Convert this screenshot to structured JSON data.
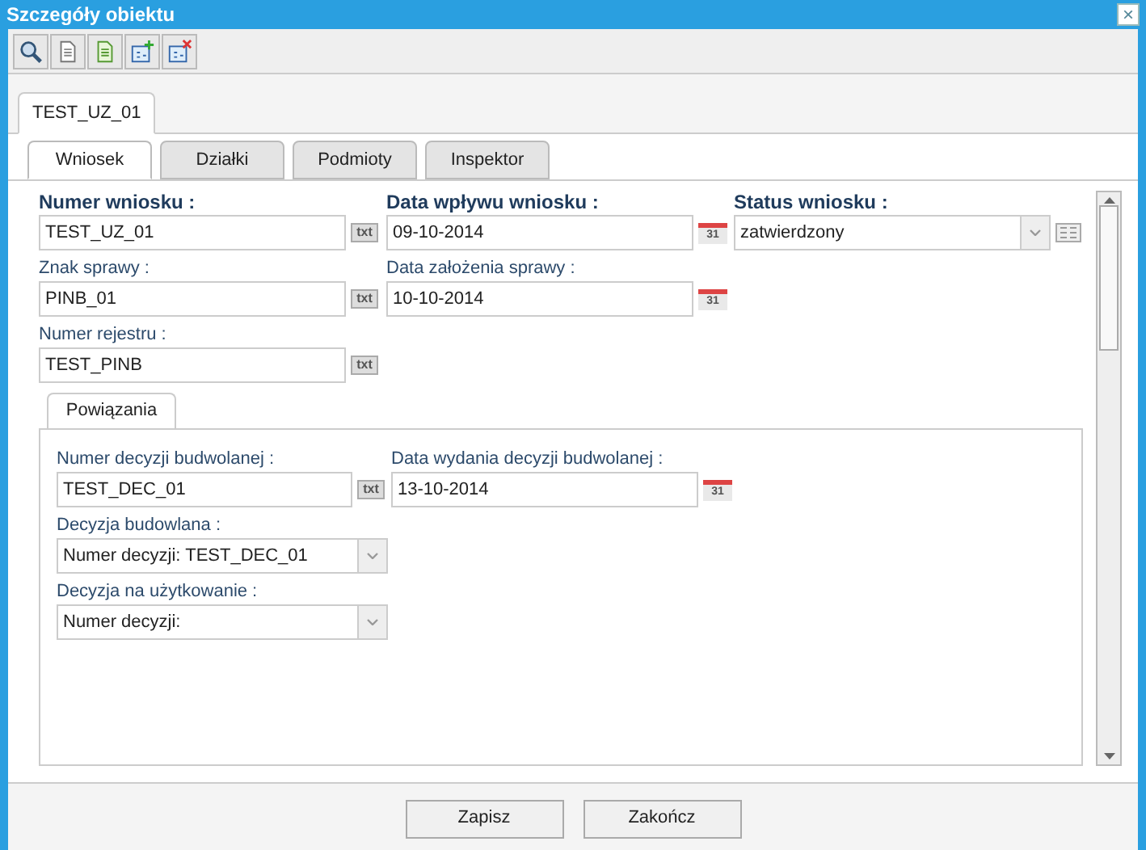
{
  "window": {
    "title": "Szczegóły obiektu",
    "close": "×"
  },
  "toolbar": [
    {
      "kind": "search"
    },
    {
      "kind": "doc"
    },
    {
      "kind": "doc-green"
    },
    {
      "kind": "add"
    },
    {
      "kind": "remove"
    }
  ],
  "object_tabs": [
    {
      "label": "TEST_UZ_01",
      "selected": true
    }
  ],
  "tabs": [
    {
      "label": "Wniosek",
      "selected": true
    },
    {
      "label": "Działki",
      "selected": false
    },
    {
      "label": "Podmioty",
      "selected": false
    },
    {
      "label": "Inspektor",
      "selected": false
    }
  ],
  "fields": [
    {
      "label": "Numer wniosku :",
      "required": true,
      "kind": "text",
      "value": "TEST_UZ_01",
      "button": "txt"
    },
    {
      "label": "Data wpływu wniosku :",
      "required": true,
      "kind": "date",
      "value": "09-10-2014",
      "button": "31"
    },
    {
      "label": "Status wniosku :",
      "required": true,
      "kind": "select",
      "value": "zatwierdzony"
    },
    {
      "label": "Znak sprawy :",
      "required": false,
      "kind": "text",
      "value": "PINB_01",
      "button": "txt"
    },
    {
      "label": "Data założenia sprawy :",
      "required": false,
      "kind": "date",
      "value": "10-10-2014",
      "button": "31"
    },
    {
      "kind": "empty"
    },
    {
      "label": "Numer rejestru :",
      "required": false,
      "kind": "text",
      "value": "TEST_PINB",
      "button": "txt"
    }
  ],
  "sub_tabs": [
    {
      "label": "Powiązania",
      "selected": true
    }
  ],
  "sub_fields": [
    {
      "label": "Numer decyzji budwolanej :",
      "required": false,
      "kind": "text",
      "value": "TEST_DEC_01",
      "button": "txt"
    },
    {
      "label": "Data wydania decyzji budwolanej :",
      "required": false,
      "kind": "date",
      "value": "13-10-2014",
      "button": "31"
    },
    {
      "label": "Decyzja budowlana :",
      "required": false,
      "kind": "select",
      "value": "Numer decyzji: TEST_DEC_01"
    },
    {
      "kind": "empty"
    },
    {
      "label": "Decyzja na użytkowanie :",
      "required": false,
      "kind": "select",
      "value": "Numer decyzji:"
    }
  ],
  "buttons": [
    "Zapisz",
    "Zakończ"
  ]
}
